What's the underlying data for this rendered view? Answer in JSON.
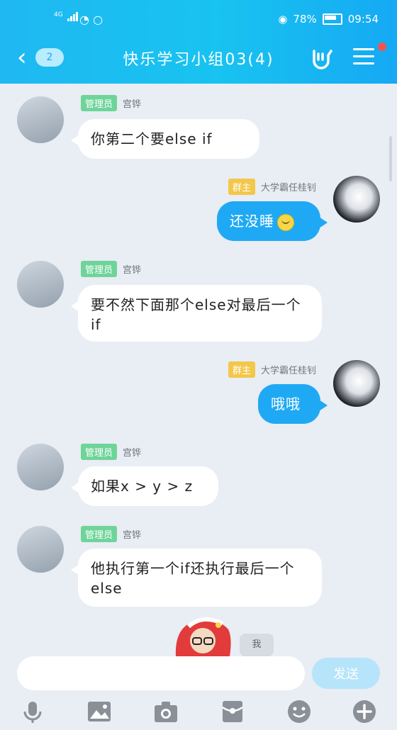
{
  "status": {
    "network": "4G",
    "battery_percent": "78%",
    "time": "09:54"
  },
  "header": {
    "back_count": "2",
    "title": "快乐学习小组03(4)"
  },
  "messages": [
    {
      "side": "left",
      "badge": "管理员",
      "sender": "宫铧",
      "text": "你第二个要else if"
    },
    {
      "side": "right",
      "badge": "群主",
      "sender": "大学霸任桂钊",
      "text": "还没睡"
    },
    {
      "side": "left",
      "badge": "管理员",
      "sender": "宫铧",
      "text": "要不然下面那个else对最后一个if"
    },
    {
      "side": "right",
      "badge": "群主",
      "sender": "大学霸任桂钊",
      "text": "哦哦"
    },
    {
      "side": "left",
      "badge": "管理员",
      "sender": "宫铧",
      "text": "如果x > y > z"
    },
    {
      "side": "left",
      "badge": "管理员",
      "sender": "宫铧",
      "text": "他执行第一个if还执行最后一个else"
    }
  ],
  "peek_text": "我",
  "input": {
    "placeholder": "",
    "send_label": "发送"
  },
  "icons": [
    "microphone-icon",
    "image-icon",
    "camera-icon",
    "red-packet-icon",
    "emoji-icon",
    "plus-icon"
  ]
}
